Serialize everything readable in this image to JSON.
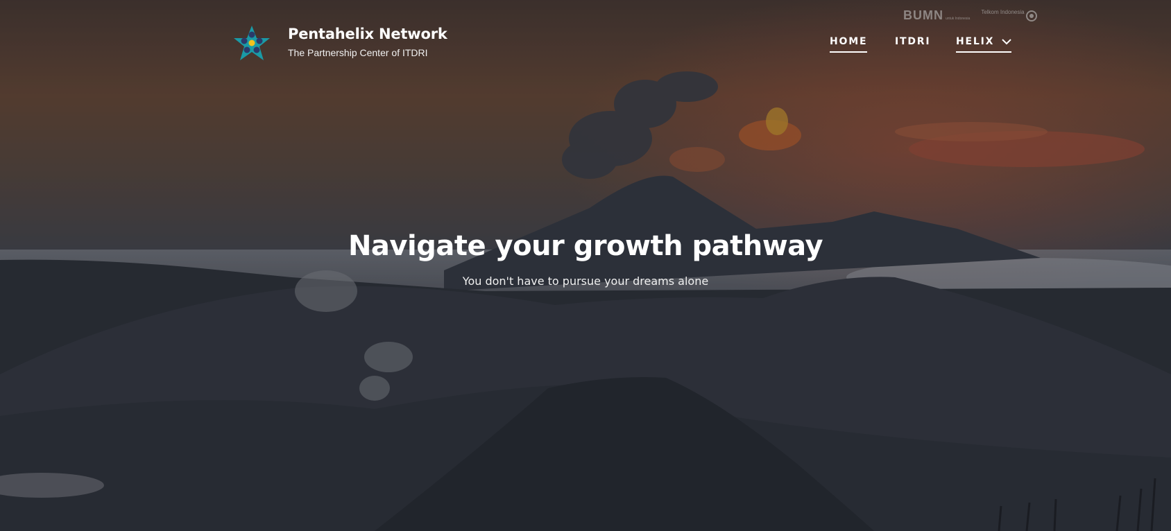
{
  "brand": {
    "name": "Pentahelix Network",
    "tagline": "The Partnership Center of ITDRI",
    "logo_icon": "pentahelix-star-logo",
    "colors": {
      "star_teal": "#1a9aa6",
      "dots_navy": "#2a3a6a",
      "center_yellow": "#f2c21c"
    }
  },
  "partners": {
    "bumn_label": "BUMN",
    "bumn_sub": "untuk Indonesia",
    "telkom_label": "Telkom Indonesia"
  },
  "nav": {
    "items": [
      {
        "label": "HOME",
        "active": true
      },
      {
        "label": "ITDRI",
        "active": false
      },
      {
        "label": "HELIX",
        "active": false,
        "has_dropdown": true
      }
    ]
  },
  "hero": {
    "headline": "Navigate your growth pathway",
    "subheadline": "You don't have to pursue your dreams alone",
    "background": "volcano-landscape-sunset"
  }
}
